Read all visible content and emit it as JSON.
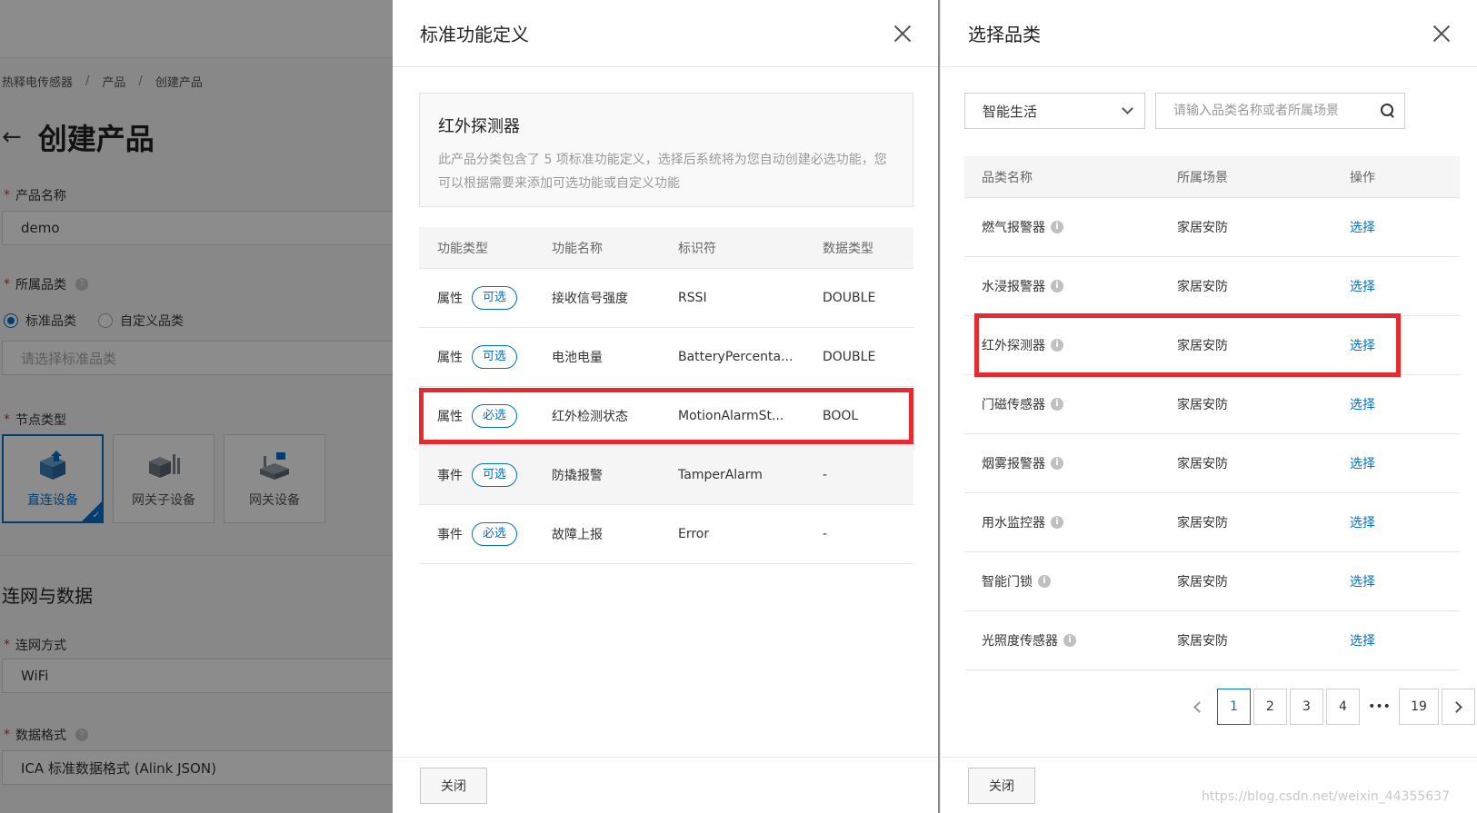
{
  "background": {
    "breadcrumb": [
      "热释电传感器",
      "产品",
      "创建产品"
    ],
    "breadcrumb_sep": "/",
    "back_arrow": "←",
    "page_title": "创建产品",
    "product_name_label": "产品名称",
    "product_name_value": "demo",
    "category_label": "所属品类",
    "radio_standard": "标准品类",
    "radio_custom": "自定义品类",
    "category_placeholder": "请选择标准品类",
    "node_type_label": "节点类型",
    "node_types": [
      "直连设备",
      "网关子设备",
      "网关设备"
    ],
    "section_network": "连网与数据",
    "network_label": "连网方式",
    "network_value": "WiFi",
    "data_format_label": "数据格式",
    "data_format_value": "ICA 标准数据格式 (Alink JSON)"
  },
  "mid_drawer": {
    "title": "标准功能定义",
    "info_title": "红外探测器",
    "info_desc": "此产品分类包含了 5 项标准功能定义，选择后系统将为您自动创建必选功能，您可以根据需要来添加可选功能或自定义功能",
    "columns": [
      "功能类型",
      "功能名称",
      "标识符",
      "数据类型"
    ],
    "rows": [
      {
        "type": "属性",
        "tag": "可选",
        "name": "接收信号强度",
        "id": "RSSI",
        "dtype": "DOUBLE"
      },
      {
        "type": "属性",
        "tag": "可选",
        "name": "电池电量",
        "id": "BatteryPercenta...",
        "dtype": "DOUBLE"
      },
      {
        "type": "属性",
        "tag": "必选",
        "name": "红外检测状态",
        "id": "MotionAlarmSt...",
        "dtype": "BOOL"
      },
      {
        "type": "事件",
        "tag": "可选",
        "name": "防撬报警",
        "id": "TamperAlarm",
        "dtype": "-"
      },
      {
        "type": "事件",
        "tag": "必选",
        "name": "故障上报",
        "id": "Error",
        "dtype": "-"
      }
    ],
    "close_button": "关闭"
  },
  "right_drawer": {
    "title": "选择品类",
    "scene_select": "智能生活",
    "search_placeholder": "请输入品类名称或者所属场景",
    "columns": [
      "品类名称",
      "所属场景",
      "操作"
    ],
    "rows": [
      {
        "name": "燃气报警器",
        "scene": "家居安防",
        "action": "选择"
      },
      {
        "name": "水浸报警器",
        "scene": "家居安防",
        "action": "选择"
      },
      {
        "name": "红外探测器",
        "scene": "家居安防",
        "action": "选择"
      },
      {
        "name": "门磁传感器",
        "scene": "家居安防",
        "action": "选择"
      },
      {
        "name": "烟雾报警器",
        "scene": "家居安防",
        "action": "选择"
      },
      {
        "name": "用水监控器",
        "scene": "家居安防",
        "action": "选择"
      },
      {
        "name": "智能门锁",
        "scene": "家居安防",
        "action": "选择"
      },
      {
        "name": "光照度传感器",
        "scene": "家居安防",
        "action": "选择"
      }
    ],
    "pager": {
      "pages": [
        "1",
        "2",
        "3",
        "4"
      ],
      "ellipsis": "•••",
      "last": "19",
      "current": "1"
    },
    "close_button": "关闭"
  },
  "watermark": "https://blog.csdn.net/weixin_44355637",
  "colors": {
    "primary": "#0070cc",
    "highlight": "#e8292e",
    "overlay": "rgba(0,0,0,0.45)"
  }
}
